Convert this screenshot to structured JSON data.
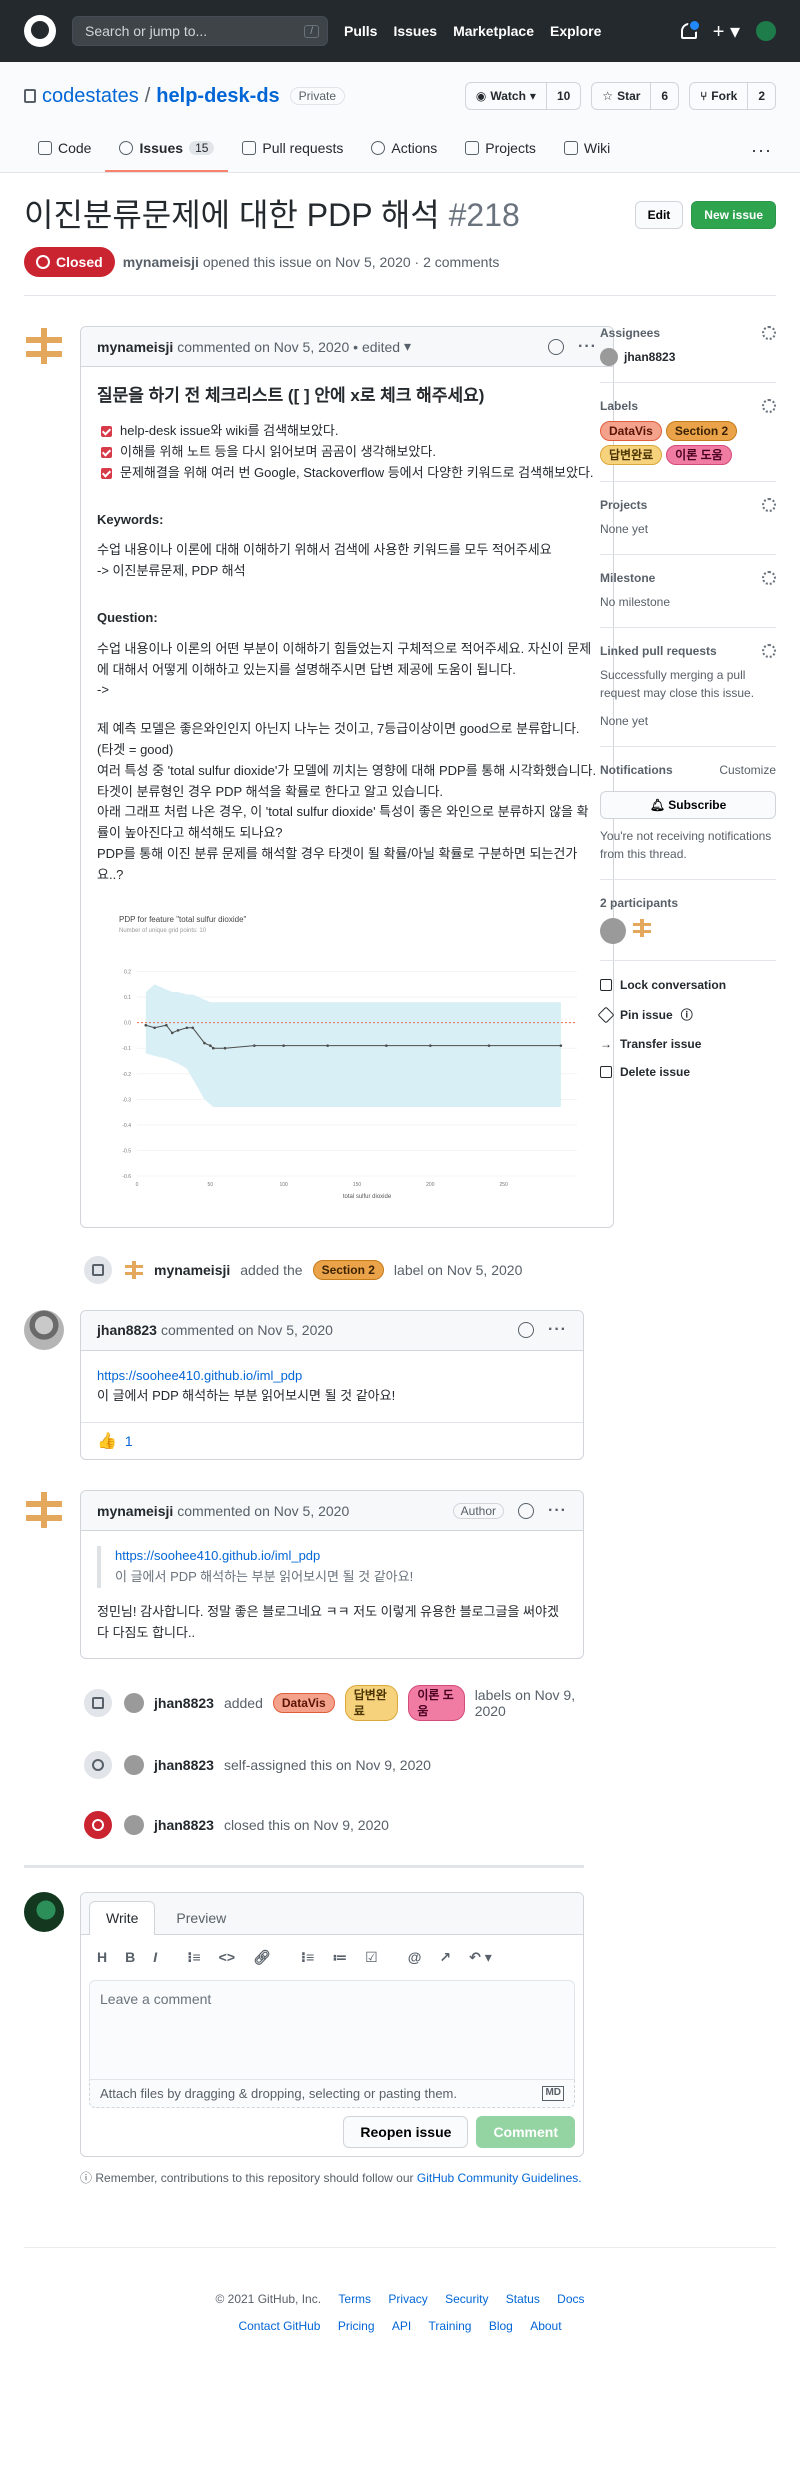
{
  "header": {
    "search_placeholder": "Search or jump to...",
    "search_key": "/",
    "nav": [
      "Pulls",
      "Issues",
      "Marketplace",
      "Explore"
    ]
  },
  "repo": {
    "owner": "codestates",
    "name": "help-desk-ds",
    "visibility": "Private",
    "watch_label": "Watch",
    "watch_count": "10",
    "star_label": "Star",
    "star_count": "6",
    "fork_label": "Fork",
    "fork_count": "2",
    "tabs": [
      {
        "label": "Code",
        "icon": "code-icon"
      },
      {
        "label": "Issues",
        "badge": "15",
        "icon": "issue-icon"
      },
      {
        "label": "Pull requests",
        "icon": "pull-request-icon"
      },
      {
        "label": "Actions",
        "icon": "play-icon"
      },
      {
        "label": "Projects",
        "icon": "project-icon"
      },
      {
        "label": "Wiki",
        "icon": "book-icon"
      }
    ]
  },
  "issue": {
    "title": "이진분류문제에 대한 PDP 해석",
    "number": "#218",
    "edit_label": "Edit",
    "new_issue_label": "New issue",
    "state": "Closed",
    "opener": "mynameisji",
    "opened_text": "opened this issue on Nov 5, 2020 · 2 comments"
  },
  "comment1": {
    "author": "mynameisji",
    "meta": "commented on Nov 5, 2020 • edited",
    "heading": "질문을 하기 전 체크리스트 ([ ] 안에 x로 체크 해주세요)",
    "checks": [
      "help-desk issue와 wiki를 검색해보았다.",
      "이해를 위해 노트 등을 다시 읽어보며 곰곰이 생각해보았다.",
      "문제해결을 위해 여러 번 Google, Stackoverflow 등에서 다양한 키워드로 검색해보았다."
    ],
    "keywords_title": "Keywords:",
    "keywords_line1": "수업 내용이나 이론에 대해 이해하기 위해서 검색에 사용한 키워드를 모두 적어주세요",
    "keywords_line2": "-> 이진분류문제, PDP 해석",
    "question_title": "Question:",
    "question_line1": "수업 내용이나 이론의 어떤 부분이 이해하기 힘들었는지 구체적으로 적어주세요. 자신이 문제에 대해서 어떻게 이해하고 있는지를 설명해주시면 답변 제공에 도움이 됩니다.",
    "question_line2": "->",
    "body": [
      "제 예측 모델은 좋은와인인지 아닌지 나누는 것이고, 7등급이상이면 good으로 분류합니다. (타겟 = good)",
      "여러 특성 중 'total sulfur dioxide'가 모델에 끼치는 영향에 대해 PDP를 통해 시각화했습니다.",
      "타겟이 분류형인 경우 PDP 해석을 확률로 한다고 알고 있습니다.",
      "아래 그래프 처럼 나온 경우, 이 'total sulfur dioxide' 특성이 좋은 와인으로 분류하지 않을 확률이 높아진다고 해석해도 되나요?",
      "PDP를 통해 이진 분류 문제를 해석할 경우 타겟이 될 확률/아닐 확률로 구분하면 되는건가요..?"
    ]
  },
  "chart_data": {
    "type": "line",
    "title": "PDP for feature \"total sulfur dioxide\"",
    "subtitle": "Number of unique grid points: 10",
    "xlabel": "total sulfur dioxide",
    "ylabel": "",
    "x": [
      6,
      12,
      20,
      24,
      28,
      34,
      38,
      46,
      50,
      52,
      60,
      80,
      100,
      130,
      170,
      200,
      240,
      289
    ],
    "y": [
      -0.01,
      -0.02,
      -0.01,
      -0.04,
      -0.03,
      -0.02,
      -0.02,
      -0.08,
      -0.09,
      -0.1,
      -0.1,
      -0.09,
      -0.09,
      -0.09,
      -0.09,
      -0.09,
      -0.09,
      -0.09
    ],
    "band_upper": [
      0.12,
      0.15,
      0.13,
      0.12,
      0.12,
      0.11,
      0.11,
      0.09,
      0.08,
      0.08,
      0.08,
      0.08,
      0.08,
      0.08,
      0.08,
      0.08,
      0.08,
      0.08
    ],
    "band_lower": [
      -0.12,
      -0.13,
      -0.14,
      -0.15,
      -0.16,
      -0.18,
      -0.22,
      -0.3,
      -0.32,
      -0.33,
      -0.33,
      -0.33,
      -0.33,
      -0.33,
      -0.33,
      -0.33,
      -0.33,
      -0.33
    ],
    "xlim": [
      0,
      300
    ],
    "ylim": [
      -0.6,
      0.3
    ],
    "xticks": [
      "0",
      "50",
      "100",
      "150",
      "200",
      "250"
    ],
    "yticks": [
      "0.2",
      "0.1",
      "0.0",
      "-0.1",
      "-0.2",
      "-0.3",
      "-0.4",
      "-0.5",
      "-0.6"
    ],
    "colors": {
      "line": "#4c4c4c",
      "band": "#d7eff5",
      "baseline": "#e05d3a"
    }
  },
  "event1": {
    "actor": "mynameisji",
    "before": "added the",
    "label": "Section 2",
    "after": "label on Nov 5, 2020"
  },
  "comment2": {
    "author": "jhan8823",
    "meta": "commented on Nov 5, 2020",
    "link": "https://soohee410.github.io/iml_pdp",
    "text": "이 글에서 PDP 해석하는 부분 읽어보시면 될 것 같아요!",
    "reaction_emoji": "👍",
    "reaction_count": "1"
  },
  "comment3": {
    "author": "mynameisji",
    "meta": "commented on Nov 5, 2020",
    "tag": "Author",
    "quote_link": "https://soohee410.github.io/iml_pdp",
    "quote_text": "이 글에서 PDP 해석하는 부분 읽어보시면 될 것 같아요!",
    "text": "정민님! 감사합니다. 정말 좋은 블로그네요 ㅋㅋ 저도 이렇게 유용한 블로그글을 써야겠다 다짐도 합니다.."
  },
  "event2": {
    "actor": "jhan8823",
    "before": "added",
    "labels": [
      "DataVis",
      "답변완료",
      "이론 도움"
    ],
    "after": "labels on Nov 9, 2020"
  },
  "event3": {
    "actor": "jhan8823",
    "text": "self-assigned this on Nov 9, 2020"
  },
  "event4": {
    "actor": "jhan8823",
    "text": "closed this on Nov 9, 2020"
  },
  "new_comment": {
    "write_tab": "Write",
    "preview_tab": "Preview",
    "tools": [
      "H",
      "B",
      "I"
    ],
    "placeholder": "Leave a comment",
    "attach_text": "Attach files by dragging & dropping, selecting or pasting them.",
    "md_icon": "MD",
    "reopen_label": "Reopen issue",
    "comment_label": "Comment",
    "remember_text": "Remember, contributions to this repository should follow our",
    "remember_link": "GitHub Community Guidelines."
  },
  "sidebar": {
    "assignees_title": "Assignees",
    "assignee": "jhan8823",
    "labels_title": "Labels",
    "labels": [
      "DataVis",
      "Section 2",
      "답변완료",
      "이론 도움"
    ],
    "projects_title": "Projects",
    "projects_value": "None yet",
    "milestone_title": "Milestone",
    "milestone_value": "No milestone",
    "linked_title": "Linked pull requests",
    "linked_text": "Successfully merging a pull request may close this issue.",
    "linked_value": "None yet",
    "notifications_title": "Notifications",
    "customize": "Customize",
    "subscribe": "Subscribe",
    "notif_text": "You're not receiving notifications from this thread.",
    "participants_title": "2 participants",
    "actions": [
      "Lock conversation",
      "Pin issue",
      "Transfer issue",
      "Delete issue"
    ]
  },
  "footer": {
    "copyright": "© 2021 GitHub, Inc.",
    "row1": [
      "Terms",
      "Privacy",
      "Security",
      "Status",
      "Docs"
    ],
    "row2": [
      "Contact GitHub",
      "Pricing",
      "API",
      "Training",
      "Blog",
      "About"
    ]
  }
}
